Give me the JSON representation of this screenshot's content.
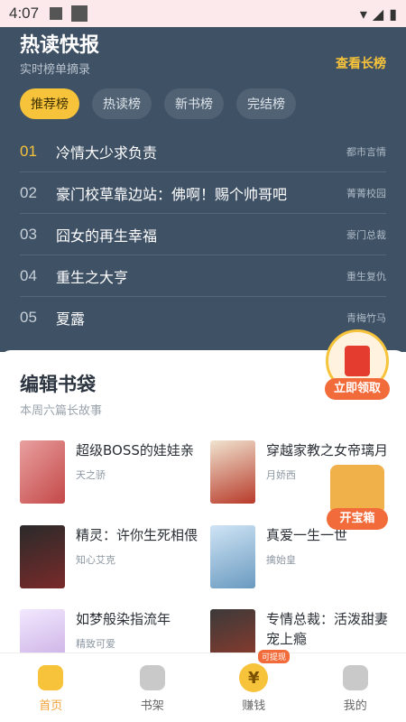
{
  "status": {
    "time": "4:07",
    "icon_a": "A"
  },
  "hot": {
    "title": "热读快报",
    "subtitle": "实时榜单摘录",
    "more": "查看长榜",
    "tabs": [
      "推荐榜",
      "热读榜",
      "新书榜",
      "完结榜"
    ],
    "items": [
      {
        "num": "01",
        "title": "冷情大少求负责",
        "tag": "都市言情"
      },
      {
        "num": "02",
        "title": "豪门校草靠边站：佛啊！赐个帅哥吧",
        "tag": "菁菁校园"
      },
      {
        "num": "03",
        "title": "囧女的再生幸福",
        "tag": "豪门总裁"
      },
      {
        "num": "04",
        "title": "重生之大亨",
        "tag": "重生复仇"
      },
      {
        "num": "05",
        "title": "夏露",
        "tag": "青梅竹马"
      }
    ]
  },
  "editor": {
    "title": "编辑书袋",
    "subtitle": "本周六篇长故事",
    "books": [
      {
        "title": "超级BOSS的娃娃亲",
        "author": "天之骄"
      },
      {
        "title": "穿越家教之女帝璃月",
        "author": "月娇西"
      },
      {
        "title": "精灵：许你生死相偎",
        "author": "知心艾克"
      },
      {
        "title": "真爱一生一世",
        "author": "擒始皇"
      },
      {
        "title": "如梦般染指流年",
        "author": "精致可爱"
      },
      {
        "title": "专情总裁：活泼甜妻宠上瘾",
        "author": ""
      }
    ]
  },
  "floating": {
    "redpack": "立即领取",
    "chest": "开宝箱"
  },
  "tabbar": {
    "items": [
      "首页",
      "书架",
      "赚钱",
      "我的"
    ],
    "badge": "可提现",
    "earn_symbol": "¥"
  }
}
